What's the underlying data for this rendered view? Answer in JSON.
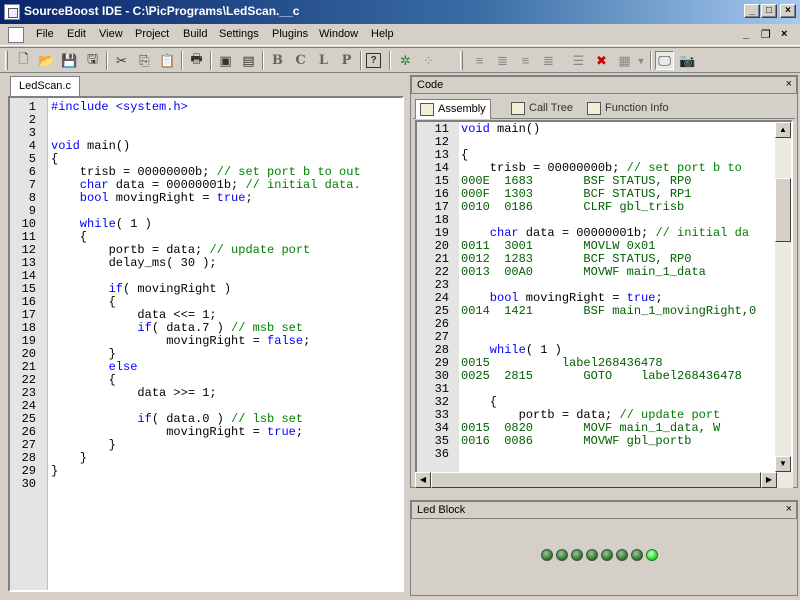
{
  "window": {
    "title": "SourceBoost IDE - C:\\PicPrograms\\LedScan.__c",
    "controls": {
      "minimize": "_",
      "maximize": "□",
      "close": "×"
    }
  },
  "menu": {
    "items": [
      "File",
      "Edit",
      "View",
      "Project",
      "Build",
      "Settings",
      "Plugins",
      "Window",
      "Help"
    ],
    "mdi_controls": {
      "minimize": "_",
      "restore": "❐",
      "close": "×"
    }
  },
  "toolbar": {
    "icons": [
      "new-file-icon",
      "open-folder-icon",
      "save-icon",
      "save-all-icon",
      "cut-icon",
      "copy-icon",
      "paste-icon",
      "print-icon",
      "build-icon",
      "rebuild-icon",
      "bold-b-icon",
      "bold-c-icon",
      "bold-l-icon",
      "bold-p-icon",
      "help-icon",
      "bug-icon",
      "step-icon",
      "indent-icon",
      "outdent-icon",
      "align-icon",
      "align2-icon",
      "list-icon",
      "delete-x-icon",
      "format-icon",
      "dropdown-icon",
      "monitor-icon",
      "camera-icon"
    ]
  },
  "editor": {
    "tab": "LedScan.c",
    "lines": [
      {
        "n": "1",
        "t": [
          {
            "c": "kw",
            "s": "#include <system.h>"
          }
        ]
      },
      {
        "n": "2",
        "t": []
      },
      {
        "n": "3",
        "t": []
      },
      {
        "n": "4",
        "t": [
          {
            "c": "kw",
            "s": "void"
          },
          {
            "c": "tx",
            "s": " main()"
          }
        ]
      },
      {
        "n": "5",
        "t": [
          {
            "c": "tx",
            "s": "{"
          }
        ]
      },
      {
        "n": "6",
        "t": [
          {
            "c": "tx",
            "s": "    trisb = 00000000b; "
          },
          {
            "c": "cm",
            "s": "// set port b to out"
          }
        ]
      },
      {
        "n": "7",
        "t": [
          {
            "c": "kw",
            "s": "    char"
          },
          {
            "c": "tx",
            "s": " data = 00000001b; "
          },
          {
            "c": "cm",
            "s": "// initial data."
          }
        ]
      },
      {
        "n": "8",
        "t": [
          {
            "c": "kw",
            "s": "    bool"
          },
          {
            "c": "tx",
            "s": " movingRight = "
          },
          {
            "c": "kw",
            "s": "true"
          },
          {
            "c": "tx",
            "s": ";"
          }
        ]
      },
      {
        "n": "9",
        "t": []
      },
      {
        "n": "10",
        "t": [
          {
            "c": "kw",
            "s": "    while"
          },
          {
            "c": "tx",
            "s": "( 1 )"
          }
        ]
      },
      {
        "n": "11",
        "t": [
          {
            "c": "tx",
            "s": "    {"
          }
        ]
      },
      {
        "n": "12",
        "t": [
          {
            "c": "tx",
            "s": "        portb = data; "
          },
          {
            "c": "cm",
            "s": "// update port"
          }
        ]
      },
      {
        "n": "13",
        "t": [
          {
            "c": "tx",
            "s": "        delay_ms( 30 );"
          }
        ]
      },
      {
        "n": "14",
        "t": []
      },
      {
        "n": "15",
        "t": [
          {
            "c": "kw",
            "s": "        if"
          },
          {
            "c": "tx",
            "s": "( movingRight )"
          }
        ]
      },
      {
        "n": "16",
        "t": [
          {
            "c": "tx",
            "s": "        {"
          }
        ]
      },
      {
        "n": "17",
        "t": [
          {
            "c": "tx",
            "s": "            data <<= 1;"
          }
        ]
      },
      {
        "n": "18",
        "t": [
          {
            "c": "kw",
            "s": "            if"
          },
          {
            "c": "tx",
            "s": "( data.7 ) "
          },
          {
            "c": "cm",
            "s": "// msb set"
          }
        ]
      },
      {
        "n": "19",
        "t": [
          {
            "c": "tx",
            "s": "                movingRight = "
          },
          {
            "c": "kw",
            "s": "false"
          },
          {
            "c": "tx",
            "s": ";"
          }
        ]
      },
      {
        "n": "20",
        "t": [
          {
            "c": "tx",
            "s": "        }"
          }
        ]
      },
      {
        "n": "21",
        "t": [
          {
            "c": "kw",
            "s": "        else"
          }
        ]
      },
      {
        "n": "22",
        "t": [
          {
            "c": "tx",
            "s": "        {"
          }
        ]
      },
      {
        "n": "23",
        "t": [
          {
            "c": "tx",
            "s": "            data >>= 1;"
          }
        ]
      },
      {
        "n": "24",
        "t": []
      },
      {
        "n": "25",
        "t": [
          {
            "c": "kw",
            "s": "            if"
          },
          {
            "c": "tx",
            "s": "( data.0 ) "
          },
          {
            "c": "cm",
            "s": "// lsb set"
          }
        ]
      },
      {
        "n": "26",
        "t": [
          {
            "c": "tx",
            "s": "                movingRight = "
          },
          {
            "c": "kw",
            "s": "true"
          },
          {
            "c": "tx",
            "s": ";"
          }
        ]
      },
      {
        "n": "27",
        "t": [
          {
            "c": "tx",
            "s": "        }"
          }
        ]
      },
      {
        "n": "28",
        "t": [
          {
            "c": "tx",
            "s": "    }"
          }
        ]
      },
      {
        "n": "29",
        "t": [
          {
            "c": "tx",
            "s": "}"
          }
        ]
      },
      {
        "n": "30",
        "t": []
      }
    ]
  },
  "code_pane": {
    "title": "Code",
    "close": "×",
    "tabs": [
      {
        "label": "Assembly",
        "active": true
      },
      {
        "label": "Call Tree",
        "active": false
      },
      {
        "label": "Function Info",
        "active": false
      }
    ],
    "lines": [
      {
        "n": "11",
        "t": [
          {
            "c": "kw",
            "s": "void"
          },
          {
            "c": "tx",
            "s": " main()"
          }
        ]
      },
      {
        "n": "12",
        "t": []
      },
      {
        "n": "13",
        "t": [
          {
            "c": "tx",
            "s": "{"
          }
        ]
      },
      {
        "n": "14",
        "t": [
          {
            "c": "tx",
            "s": "    trisb = 00000000b; "
          },
          {
            "c": "cm",
            "s": "// set port b to"
          }
        ]
      },
      {
        "n": "15",
        "t": [
          {
            "c": "asm",
            "s": "000E  1683       BSF STATUS, RP0"
          }
        ]
      },
      {
        "n": "16",
        "t": [
          {
            "c": "asm",
            "s": "000F  1303       BCF STATUS, RP1"
          }
        ]
      },
      {
        "n": "17",
        "t": [
          {
            "c": "asm",
            "s": "0010  0186       CLRF gbl_trisb"
          }
        ]
      },
      {
        "n": "18",
        "t": []
      },
      {
        "n": "19",
        "t": [
          {
            "c": "kw",
            "s": "    char"
          },
          {
            "c": "tx",
            "s": " data = 00000001b; "
          },
          {
            "c": "cm",
            "s": "// initial da"
          }
        ]
      },
      {
        "n": "20",
        "t": [
          {
            "c": "asm",
            "s": "0011  3001       MOVLW 0x01"
          }
        ]
      },
      {
        "n": "21",
        "t": [
          {
            "c": "asm",
            "s": "0012  1283       BCF STATUS, RP0"
          }
        ]
      },
      {
        "n": "22",
        "t": [
          {
            "c": "asm",
            "s": "0013  00A0       MOVWF main_1_data"
          }
        ]
      },
      {
        "n": "23",
        "t": []
      },
      {
        "n": "24",
        "t": [
          {
            "c": "kw",
            "s": "    bool"
          },
          {
            "c": "tx",
            "s": " movingRight = "
          },
          {
            "c": "kw",
            "s": "true"
          },
          {
            "c": "tx",
            "s": ";"
          }
        ]
      },
      {
        "n": "25",
        "t": [
          {
            "c": "asm",
            "s": "0014  1421       BSF main_1_movingRight,0"
          }
        ]
      },
      {
        "n": "26",
        "t": []
      },
      {
        "n": "27",
        "t": []
      },
      {
        "n": "28",
        "t": [
          {
            "c": "kw",
            "s": "    while"
          },
          {
            "c": "tx",
            "s": "( 1 )"
          }
        ]
      },
      {
        "n": "29",
        "t": [
          {
            "c": "asm",
            "s": "0015          label268436478"
          }
        ]
      },
      {
        "n": "30",
        "t": [
          {
            "c": "asm",
            "s": "0025  2815       GOTO    label268436478"
          }
        ]
      },
      {
        "n": "31",
        "t": []
      },
      {
        "n": "32",
        "t": [
          {
            "c": "tx",
            "s": "    {"
          }
        ]
      },
      {
        "n": "33",
        "t": [
          {
            "c": "tx",
            "s": "        portb = data; "
          },
          {
            "c": "cm",
            "s": "// update port"
          }
        ]
      },
      {
        "n": "34",
        "t": [
          {
            "c": "asm",
            "s": "0015  0820       MOVF main_1_data, W"
          }
        ]
      },
      {
        "n": "35",
        "t": [
          {
            "c": "asm",
            "s": "0016  0086       MOVWF gbl_portb"
          }
        ]
      },
      {
        "n": "36",
        "t": []
      }
    ]
  },
  "led_pane": {
    "title": "Led Block",
    "close": "×",
    "leds": [
      false,
      false,
      false,
      false,
      false,
      false,
      false,
      true
    ]
  }
}
